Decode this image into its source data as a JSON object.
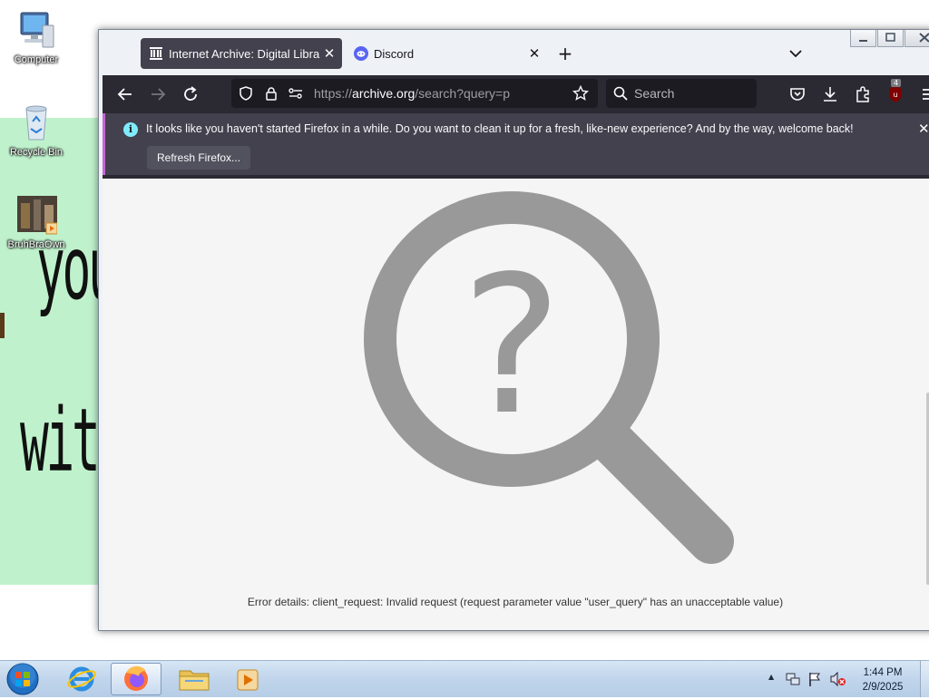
{
  "desktop": {
    "icons": [
      {
        "label": "Computer"
      },
      {
        "label": "Recycle Bin"
      },
      {
        "label": "BruhBraOwn"
      }
    ],
    "wallpaper_text": [
      "you",
      "with"
    ]
  },
  "browser": {
    "tabs": [
      {
        "title": "Internet Archive: Digital Library",
        "active": true,
        "icon": "archive-icon"
      },
      {
        "title": "Discord",
        "active": false,
        "icon": "discord-icon"
      }
    ],
    "url": {
      "protocol": "https://",
      "host": "archive.org",
      "path": "/search?query=p"
    },
    "search_placeholder": "Search",
    "extension_badge": "4",
    "notification": {
      "message": "It looks like you haven't started Firefox in a while. Do you want to clean it up for a fresh, like-new experience? And by the way, welcome back!",
      "button_label": "Refresh Firefox..."
    },
    "error_details": "Error details: client_request: Invalid request (request parameter value \"user_query\" has an unacceptable value)",
    "magnifier_glyph": "?"
  },
  "taskbar": {
    "clock_time": "1:44 PM",
    "clock_date": "2/9/2025",
    "tray_arrow": "▲"
  },
  "colors": {
    "toolbar": "#2b2a33",
    "active_tab": "#42414d",
    "notification_accent": "#c567d9",
    "info_icon": "#80ebff",
    "magnifier": "#999999"
  }
}
